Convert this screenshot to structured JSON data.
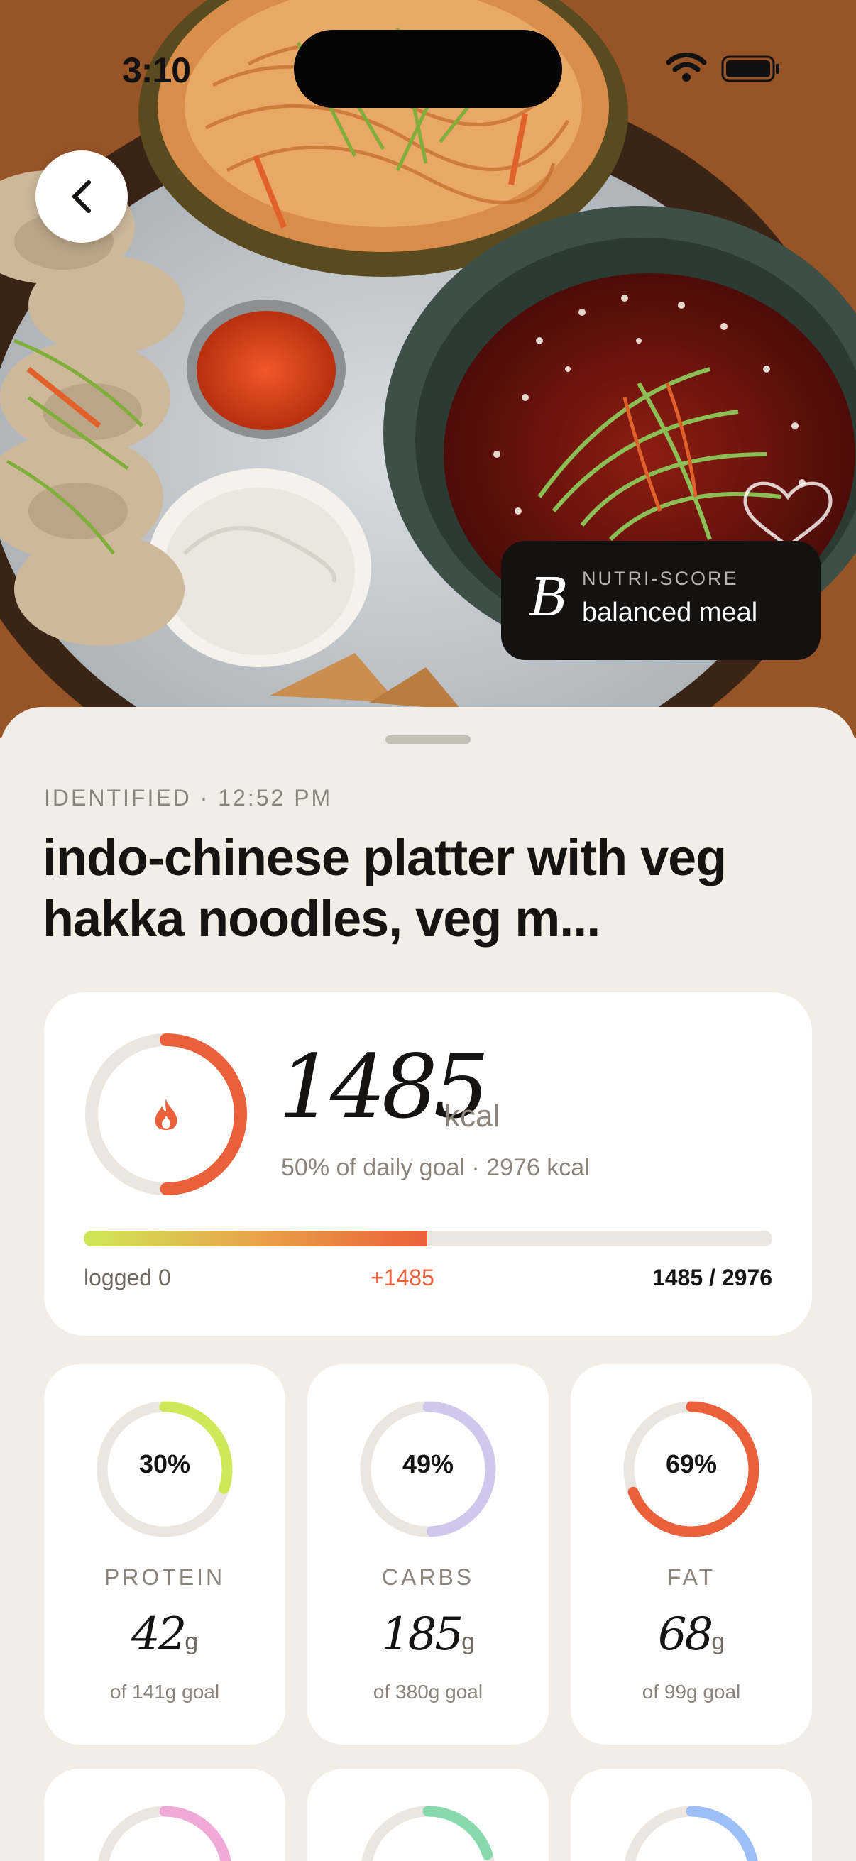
{
  "status_bar": {
    "time": "3:10"
  },
  "nav": {
    "back_icon": "chevron-left-icon"
  },
  "nutri_score": {
    "grade": "B",
    "label": "NUTRI-SCORE",
    "value": "balanced meal"
  },
  "meal": {
    "meta": "IDENTIFIED · 12:52 PM",
    "title": "indo-chinese platter with veg hakka noodles, veg m..."
  },
  "calories": {
    "icon": "flame-icon",
    "value": "1485",
    "unit": "kcal",
    "subtitle": "50% of daily goal · 2976 kcal",
    "goal_fraction": 0.499,
    "ring_color": "#e9603a",
    "logged_label": "logged 0",
    "added_label": "+1485",
    "total_label": "1485 / 2976"
  },
  "macros": [
    {
      "pct_label": "30%",
      "fraction": 0.3,
      "name": "PROTEIN",
      "amount": "42",
      "unit": "g",
      "goal": "of 141g goal",
      "color": "#cfe85a"
    },
    {
      "pct_label": "49%",
      "fraction": 0.49,
      "name": "CARBS",
      "amount": "185",
      "unit": "g",
      "goal": "of 380g goal",
      "color": "#cfc8ec"
    },
    {
      "pct_label": "69%",
      "fraction": 0.69,
      "name": "FAT",
      "amount": "68",
      "unit": "g",
      "goal": "of 99g goal",
      "color": "#e9603a"
    }
  ],
  "micros": [
    {
      "fraction": 0.25,
      "color": "#efaad6"
    },
    {
      "fraction": 0.2,
      "color": "#87d9ae"
    },
    {
      "fraction": 0.6,
      "color": "#9dbff8"
    }
  ],
  "colors": {
    "background": "#f2eee7",
    "card": "#ffffff",
    "ring_track": "#ebe7e0"
  }
}
